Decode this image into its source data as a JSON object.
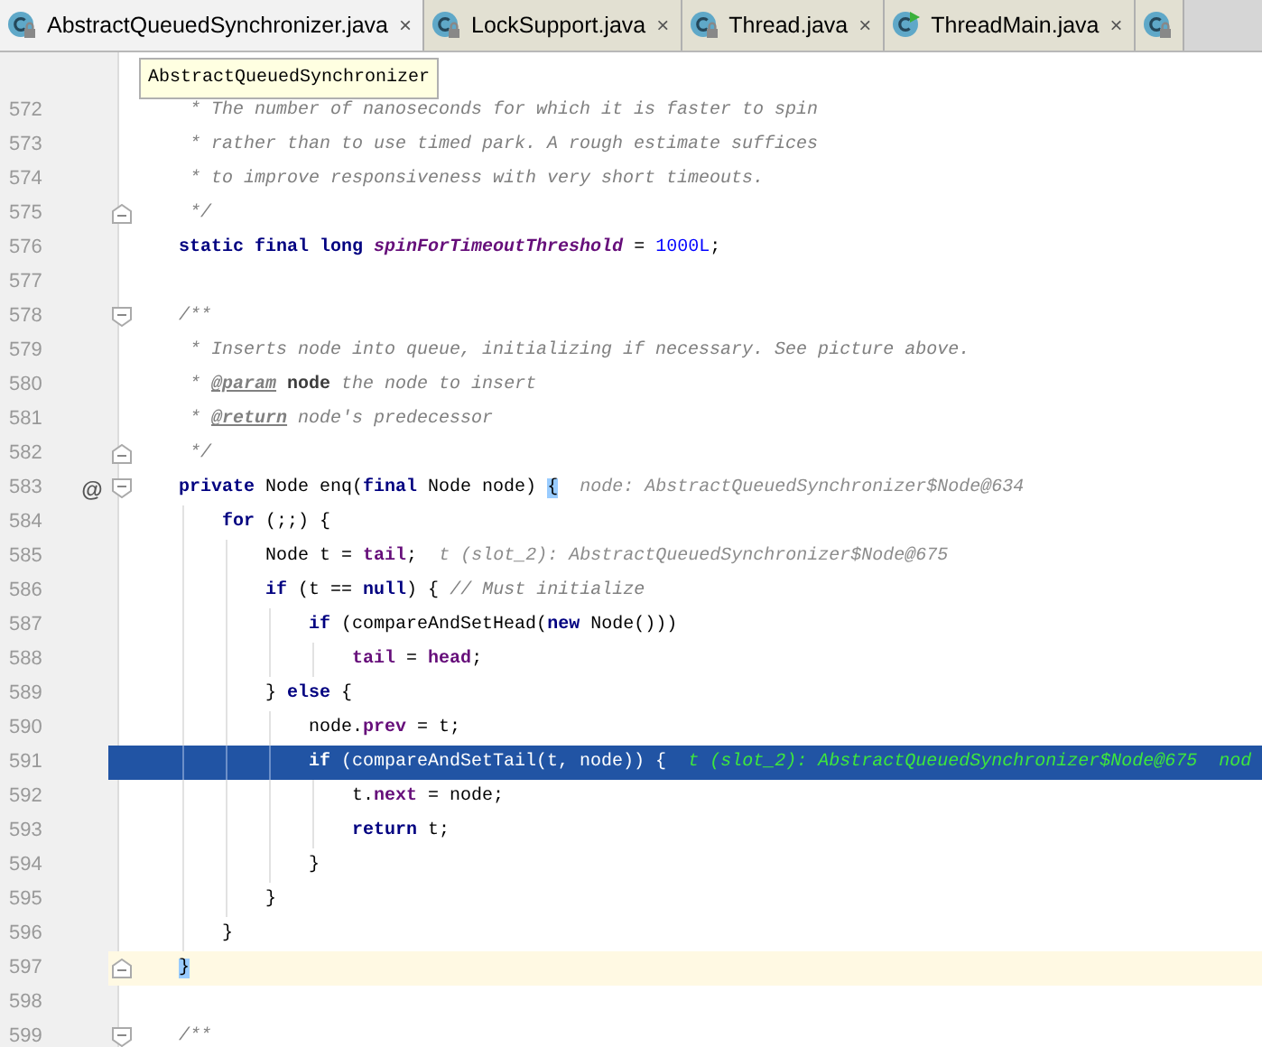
{
  "tabs": [
    {
      "label": "AbstractQueuedSynchronizer.java",
      "kind": "class_locked",
      "selected": true,
      "close": "×"
    },
    {
      "label": "LockSupport.java",
      "kind": "class_locked",
      "selected": false,
      "close": "×"
    },
    {
      "label": "Thread.java",
      "kind": "class_locked",
      "selected": false,
      "close": "×"
    },
    {
      "label": "ThreadMain.java",
      "kind": "class_runnable",
      "selected": false,
      "close": "×"
    },
    {
      "kind": "class_locked",
      "selected": false
    }
  ],
  "tooltip": "AbstractQueuedSynchronizer",
  "lines": [
    {
      "number": "572",
      "current": false,
      "caret": false,
      "code": [
        {
          "kind": "comment",
          "text": "     * The number of nanoseconds for which it is faster to spin"
        }
      ]
    },
    {
      "number": "573",
      "current": false,
      "caret": false,
      "code": [
        {
          "kind": "comment",
          "text": "     * rather than to use timed park. A rough estimate suffices"
        }
      ]
    },
    {
      "number": "574",
      "current": false,
      "caret": false,
      "code": [
        {
          "kind": "comment",
          "text": "     * to improve responsiveness with very short timeouts."
        }
      ]
    },
    {
      "number": "575",
      "current": false,
      "caret": false,
      "fold": {
        "kind": "end"
      },
      "code": [
        {
          "kind": "comment",
          "text": "     */"
        }
      ]
    },
    {
      "number": "576",
      "current": false,
      "caret": false,
      "code": [
        {
          "kind": "kw",
          "text": "    static final long "
        },
        {
          "kind": "static_field",
          "text": "spinForTimeoutThreshold"
        },
        {
          "kind": "plain",
          "text": " = "
        },
        {
          "kind": "num",
          "text": "1000L"
        },
        {
          "kind": "plain",
          "text": ";"
        }
      ]
    },
    {
      "number": "577",
      "current": false,
      "caret": false
    },
    {
      "number": "578",
      "current": false,
      "caret": false,
      "fold": {
        "kind": "start"
      },
      "code": [
        {
          "kind": "comment",
          "text": "    /**"
        }
      ]
    },
    {
      "number": "579",
      "current": false,
      "caret": false,
      "code": [
        {
          "kind": "comment",
          "text": "     * Inserts node into queue, initializing if necessary. See picture above."
        }
      ]
    },
    {
      "number": "580",
      "current": false,
      "caret": false,
      "code": [
        {
          "kind": "comment",
          "text": "     * "
        },
        {
          "kind": "doc_tag",
          "text": "@param"
        },
        {
          "kind": "doc_param",
          "text": " node"
        },
        {
          "kind": "comment",
          "text": " the node to insert"
        }
      ]
    },
    {
      "number": "581",
      "current": false,
      "caret": false,
      "code": [
        {
          "kind": "comment",
          "text": "     * "
        },
        {
          "kind": "doc_tag",
          "text": "@return"
        },
        {
          "kind": "comment",
          "text": " node's predecessor"
        }
      ]
    },
    {
      "number": "582",
      "current": false,
      "caret": false,
      "fold": {
        "kind": "end"
      },
      "code": [
        {
          "kind": "comment",
          "text": "     */"
        }
      ]
    },
    {
      "number": "583",
      "current": false,
      "caret": false,
      "fold": {
        "kind": "start"
      },
      "marker": "@",
      "code": [
        {
          "kind": "kw",
          "text": "    private"
        },
        {
          "kind": "plain",
          "text": " Node enq("
        },
        {
          "kind": "kw",
          "text": "final"
        },
        {
          "kind": "plain",
          "text": " Node node) "
        },
        {
          "kind": "brace_match",
          "text": "{"
        }
      ],
      "inline_value": "node: AbstractQueuedSynchronizer$Node@634"
    },
    {
      "number": "584",
      "current": false,
      "caret": false,
      "code": [
        {
          "kind": "kw",
          "text": "        for"
        },
        {
          "kind": "plain",
          "text": " (;;) {"
        }
      ]
    },
    {
      "number": "585",
      "current": false,
      "caret": false,
      "code": [
        {
          "kind": "plain",
          "text": "            Node t = "
        },
        {
          "kind": "field",
          "text": "tail"
        },
        {
          "kind": "plain",
          "text": ";"
        }
      ],
      "inline_value": "t (slot_2): AbstractQueuedSynchronizer$Node@675"
    },
    {
      "number": "586",
      "current": false,
      "caret": false,
      "code": [
        {
          "kind": "kw",
          "text": "            if"
        },
        {
          "kind": "plain",
          "text": " (t == "
        },
        {
          "kind": "kw",
          "text": "null"
        },
        {
          "kind": "plain",
          "text": ") { "
        },
        {
          "kind": "comment",
          "text": "// Must initialize"
        }
      ]
    },
    {
      "number": "587",
      "current": false,
      "caret": false,
      "code": [
        {
          "kind": "kw",
          "text": "                if"
        },
        {
          "kind": "plain",
          "text": " (compareAndSetHead("
        },
        {
          "kind": "kw",
          "text": "new"
        },
        {
          "kind": "plain",
          "text": " Node()))"
        }
      ]
    },
    {
      "number": "588",
      "current": false,
      "caret": false,
      "code": [
        {
          "kind": "field",
          "text": "                    tail"
        },
        {
          "kind": "plain",
          "text": " = "
        },
        {
          "kind": "field",
          "text": "head"
        },
        {
          "kind": "plain",
          "text": ";"
        }
      ]
    },
    {
      "number": "589",
      "current": false,
      "caret": false,
      "code": [
        {
          "kind": "plain",
          "text": "            } "
        },
        {
          "kind": "kw",
          "text": "else"
        },
        {
          "kind": "plain",
          "text": " {"
        }
      ]
    },
    {
      "number": "590",
      "current": false,
      "caret": false,
      "code": [
        {
          "kind": "plain",
          "text": "                node."
        },
        {
          "kind": "field",
          "text": "prev"
        },
        {
          "kind": "plain",
          "text": " = t;"
        }
      ]
    },
    {
      "number": "591",
      "current": true,
      "caret": false,
      "code": [
        {
          "kind": "kw",
          "text": "                if"
        },
        {
          "kind": "plain",
          "text": " (compareAndSetTail(t, node)) {"
        }
      ],
      "inline_value": "t (slot_2): AbstractQueuedSynchronizer$Node@675  nod"
    },
    {
      "number": "592",
      "current": false,
      "caret": false,
      "code": [
        {
          "kind": "plain",
          "text": "                    t."
        },
        {
          "kind": "field",
          "text": "next"
        },
        {
          "kind": "plain",
          "text": " = node;"
        }
      ]
    },
    {
      "number": "593",
      "current": false,
      "caret": false,
      "code": [
        {
          "kind": "kw",
          "text": "                    return"
        },
        {
          "kind": "plain",
          "text": " t;"
        }
      ]
    },
    {
      "number": "594",
      "current": false,
      "caret": false,
      "code": [
        {
          "kind": "plain",
          "text": "                }"
        }
      ]
    },
    {
      "number": "595",
      "current": false,
      "caret": false,
      "code": [
        {
          "kind": "plain",
          "text": "            }"
        }
      ]
    },
    {
      "number": "596",
      "current": false,
      "caret": false,
      "code": [
        {
          "kind": "plain",
          "text": "        }"
        }
      ]
    },
    {
      "number": "597",
      "current": false,
      "caret": true,
      "fold": {
        "kind": "end"
      },
      "code": [
        {
          "kind": "brace_match",
          "text": "    }"
        }
      ]
    },
    {
      "number": "598",
      "current": false,
      "caret": false
    },
    {
      "number": "599",
      "current": false,
      "caret": false,
      "fold": {
        "kind": "start"
      },
      "code": [
        {
          "kind": "comment",
          "text": "    /**"
        }
      ]
    }
  ]
}
